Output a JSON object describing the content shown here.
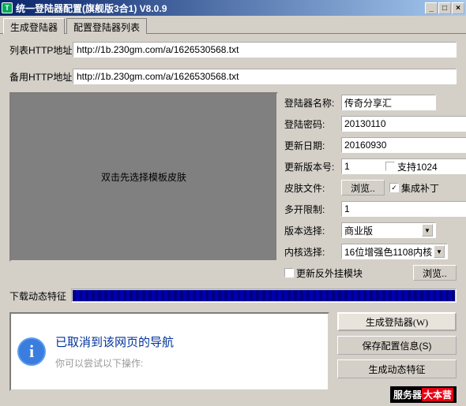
{
  "window": {
    "title": "统一登陆器配置(旗舰版3合1) V8.0.9"
  },
  "tabs": {
    "active": "生成登陆器",
    "inactive": "配置登陆器列表"
  },
  "urls": {
    "list_label": "列表HTTP地址",
    "list_value": "http://1b.230gm.com/a/1626530568.txt",
    "backup_label": "备用HTTP地址",
    "backup_value": "http://1b.230gm.com/a/1626530568.txt"
  },
  "preview": {
    "hint": "双击先选择模板皮肤"
  },
  "settings": {
    "name_label": "登陆器名称:",
    "name_value": "传奇分享汇",
    "pwd_label": "登陆密码:",
    "pwd_value": "20130110",
    "date_label": "更新日期:",
    "date_value": "20160930",
    "ver_label": "更新版本号:",
    "ver_value": "1",
    "skin_label": "皮肤文件:",
    "browse": "浏览..",
    "limit_label": "多开限制:",
    "limit_value": "1",
    "vsel_label": "版本选择:",
    "vsel_value": "商业版",
    "kernel_label": "内核选择:",
    "kernel_value": "16位增强色1108内核",
    "chk1024": "支持1024",
    "chkpatch": "集成补丁",
    "chkanti": "更新反外挂模块"
  },
  "feature": {
    "label": "下载动态特征"
  },
  "msg": {
    "title": "已取消到该网页的导航",
    "sub": "你可以尝试以下操作:"
  },
  "buttons": {
    "gen": "生成登陆器(W)",
    "save": "保存配置信息(S)",
    "feat": "生成动态特征"
  },
  "ad": {
    "left": "服务器",
    "right": "大本营"
  }
}
